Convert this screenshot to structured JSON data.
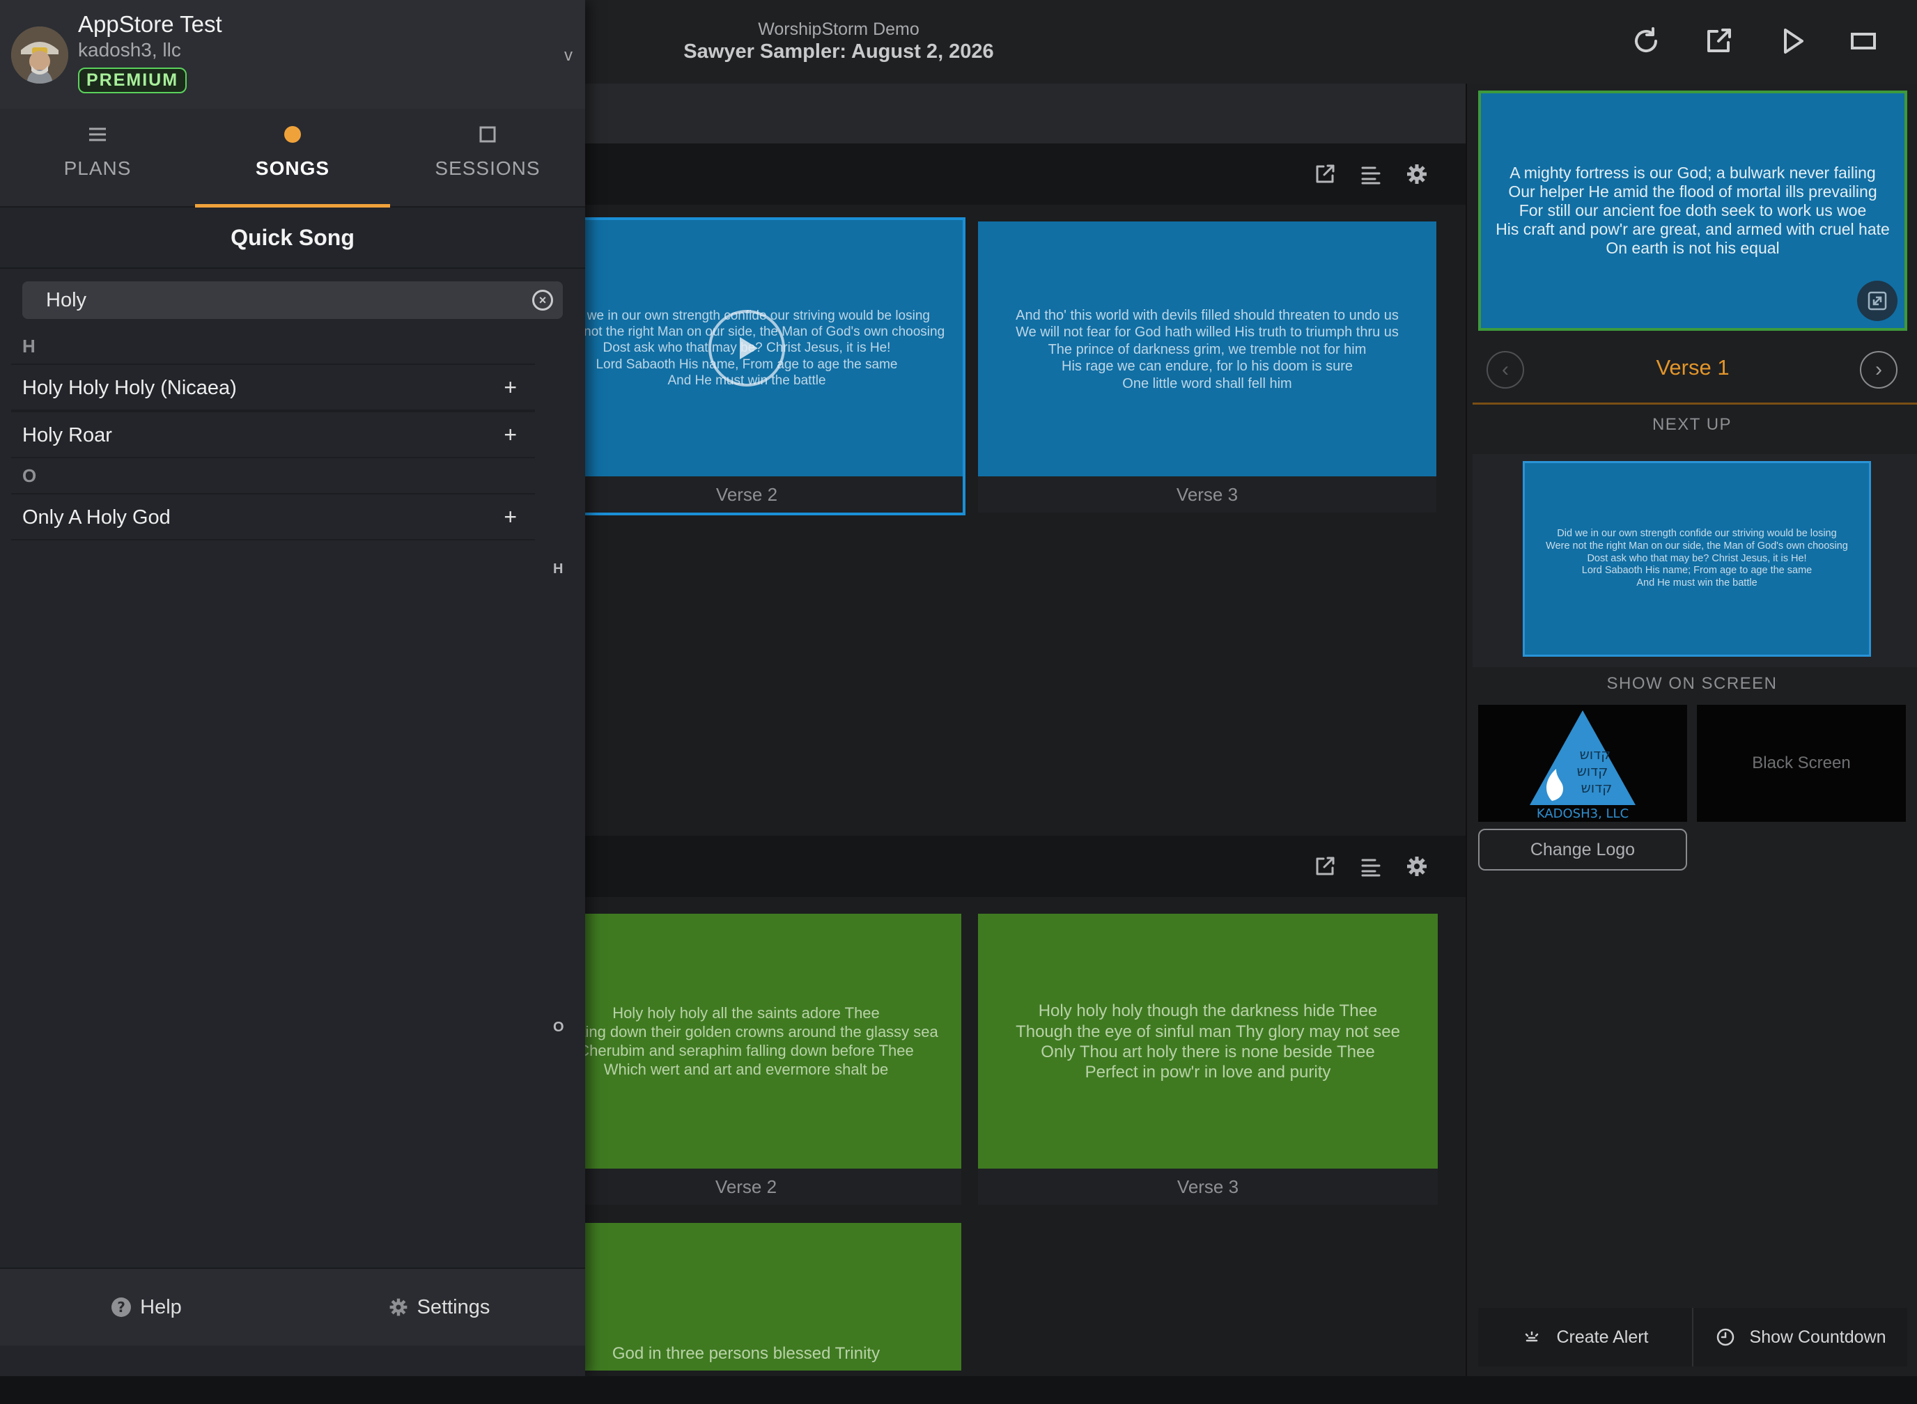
{
  "header": {
    "workspace_name": "WorshipStorm Demo",
    "plan_title": "Sawyer Sampler: August 2, 2026",
    "icons": [
      "refresh-icon",
      "edit-icon",
      "play-icon",
      "screen-icon"
    ]
  },
  "sections": [
    {
      "icons": [
        "edit-icon",
        "list-icon",
        "gear-icon"
      ],
      "slides": [
        {
          "caption": "Verse 2",
          "text": "Did we in our own strength confide our striving would be losing\nWere not the right Man on our side, the Man of God's own choosing\nDost ask who that may be? Christ Jesus, it is He!\nLord Sabaoth His name, From age to age the same\nAnd He must win the battle"
        },
        {
          "caption": "Verse 3",
          "text": "And tho' this world with devils filled should threaten to undo us\nWe will not fear for God hath willed His truth to triumph thru us\nThe prince of darkness grim, we tremble not for him\nHis rage we can endure, for lo his doom is sure\nOne little word shall fell him"
        }
      ]
    },
    {
      "icons": [
        "edit-icon",
        "list-icon",
        "gear-icon"
      ],
      "slides": [
        {
          "caption": "Verse 2",
          "text": "Holy holy holy all the saints adore Thee\nCasting down their golden crowns around the glassy sea\nCherubim and seraphim falling down before Thee\nWhich wert and art and evermore shalt be"
        },
        {
          "caption": "Verse 3",
          "text": "Holy holy holy though the darkness hide Thee\nThough the eye of sinful man Thy glory may not see\nOnly Thou art holy there is none beside Thee\nPerfect in pow'r in love and purity"
        },
        {
          "caption": "",
          "text": "God in three persons blessed Trinity"
        }
      ]
    }
  ],
  "right_panel": {
    "live_text": "A mighty fortress is our God; a bulwark never failing\nOur helper He amid the flood of mortal ills prevailing\nFor still our ancient foe doth seek to work us woe\nHis craft and pow'r are great, and armed with cruel hate\nOn earth is not his equal",
    "verse_name": "Verse 1",
    "prev_glyph": "‹",
    "next_glyph": "›",
    "next_up_label": "NEXT UP",
    "next_up_text": "Did we in our own strength confide our striving would be losing\nWere not the right Man on our side, the Man of God's own choosing\nDost ask who that may be? Christ Jesus, it is He!\nLord Sabaoth His name; From age to age the same\nAnd He must win the battle",
    "show_on_screen_label": "SHOW ON SCREEN",
    "logo_text": "KADOSH3, LLC",
    "logo_hebrew": "קדוש",
    "black_screen_label": "Black Screen",
    "change_logo_label": "Change Logo",
    "create_alert_label": "Create Alert",
    "show_countdown_label": "Show Countdown"
  },
  "drawer": {
    "account_name": "AppStore Test",
    "account_org": "kadosh3, llc",
    "badge": "PREMIUM",
    "caret": "v",
    "tabs": [
      {
        "label": "PLANS",
        "icon": "menu-icon"
      },
      {
        "label": "SONGS",
        "icon": "dot-icon"
      },
      {
        "label": "SESSIONS",
        "icon": "square-icon"
      }
    ],
    "quick_song_title": "Quick Song",
    "search_value": "Holy",
    "groups": [
      {
        "letter": "H",
        "songs": [
          "Holy Holy Holy (Nicaea)",
          "Holy Roar"
        ]
      },
      {
        "letter": "O",
        "songs": [
          "Only A Holy God"
        ]
      }
    ],
    "add_glyph": "+",
    "index_letters": [
      "H",
      "O"
    ],
    "help_label": "Help",
    "settings_label": "Settings"
  },
  "colors": {
    "accent_orange": "#f0a23a",
    "premium_green": "#5bd35b",
    "slide_blue": "#116fa4",
    "slide_green": "#3f7a21",
    "verse_label": "#e3962a"
  }
}
